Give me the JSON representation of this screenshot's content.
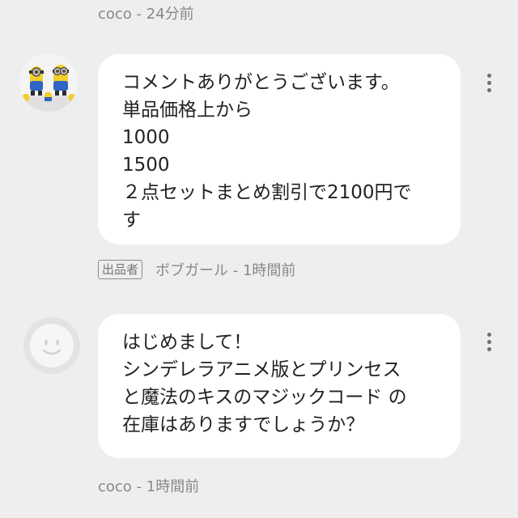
{
  "comments": [
    {
      "position": "top-meta",
      "author": "coco",
      "time": "24分前",
      "meta_text": "coco - 24分前"
    },
    {
      "author": "ボブガール",
      "badge": "出品者",
      "time": "1時間前",
      "meta_text": "ボブガール - 1時間前",
      "avatar_icon": "minion-figures-avatar",
      "lines": [
        "コメントありがとうございます。",
        "単品価格上から",
        "1000",
        "1500",
        "２点セットまとめ割引で2100円で",
        "す"
      ]
    },
    {
      "author": "coco",
      "time": "1時間前",
      "meta_text": "coco - 1時間前",
      "avatar_icon": "default-face-avatar",
      "lines": [
        "はじめまして！",
        "シンデレラアニメ版とプリンセス",
        "と魔法のキスのマジックコード の",
        "在庫はありますでしょうか？"
      ]
    }
  ],
  "colors": {
    "background": "#eeeeee",
    "bubble": "#ffffff",
    "meta_text": "#888888",
    "body_text": "#222222"
  },
  "icons": {
    "menu": "more-vertical-icon"
  }
}
